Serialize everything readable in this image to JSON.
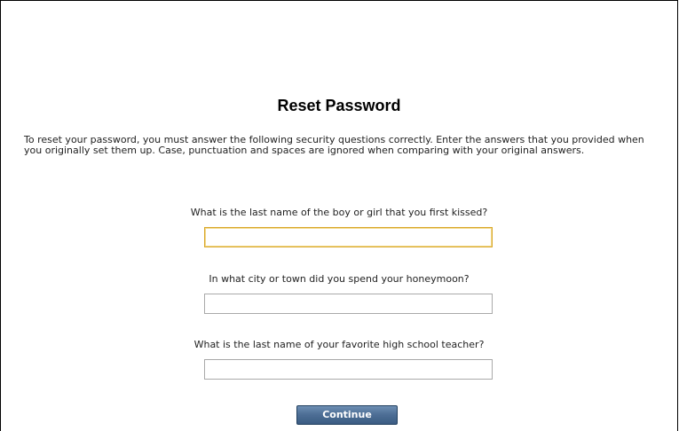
{
  "page": {
    "title": "Reset Password",
    "intro": "To reset your password, you must answer the following security questions correctly. Enter the answers that you provided when you originally set them up. Case, punctuation and spaces are ignored when comparing with your original answers."
  },
  "questions": [
    {
      "label": "What is the last name of the boy or girl that you first kissed?",
      "value": ""
    },
    {
      "label": "In what city or town did you spend your honeymoon?",
      "value": ""
    },
    {
      "label": "What is the last name of your favorite high school teacher?",
      "value": ""
    }
  ],
  "actions": {
    "continue_label": "Continue"
  },
  "colors": {
    "button_top": "#6e8fb4",
    "button_bottom": "#3b5c83",
    "focus_border": "#d9a82c",
    "input_border": "#a9a9a9"
  }
}
